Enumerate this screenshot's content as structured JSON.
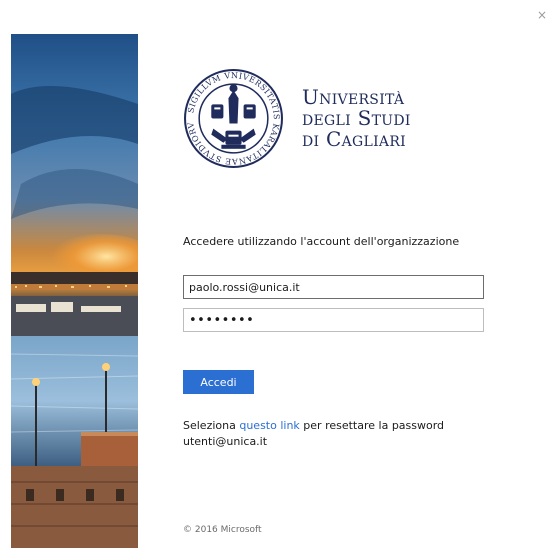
{
  "window": {
    "close_glyph": "×"
  },
  "hero": {
    "icon": "harbor-night-photo"
  },
  "logo": {
    "icon": "university-seal-icon",
    "seal_text": "SIGILLVM VNIVERSITATIS KARALITANAE STVDIORVM",
    "name_line1": "Università",
    "name_line2": "degli Studi",
    "name_line3": "di Cagliari",
    "color": "#1f2c5c"
  },
  "form": {
    "prompt": "Accedere utilizzando l'account dell'organizzazione",
    "email_value": "paolo.rossi@unica.it",
    "password_value": "abcdefgh",
    "submit_label": "Accedi"
  },
  "help": {
    "prefix": "Seleziona ",
    "link_text": "questo link",
    "suffix": " per resettare la password",
    "line2": "utenti@unica.it"
  },
  "footer": {
    "copyright": "© 2016 Microsoft"
  },
  "colors": {
    "accent": "#2b6fd3",
    "text": "#1b1b1b",
    "muted": "#6a6a6a"
  }
}
